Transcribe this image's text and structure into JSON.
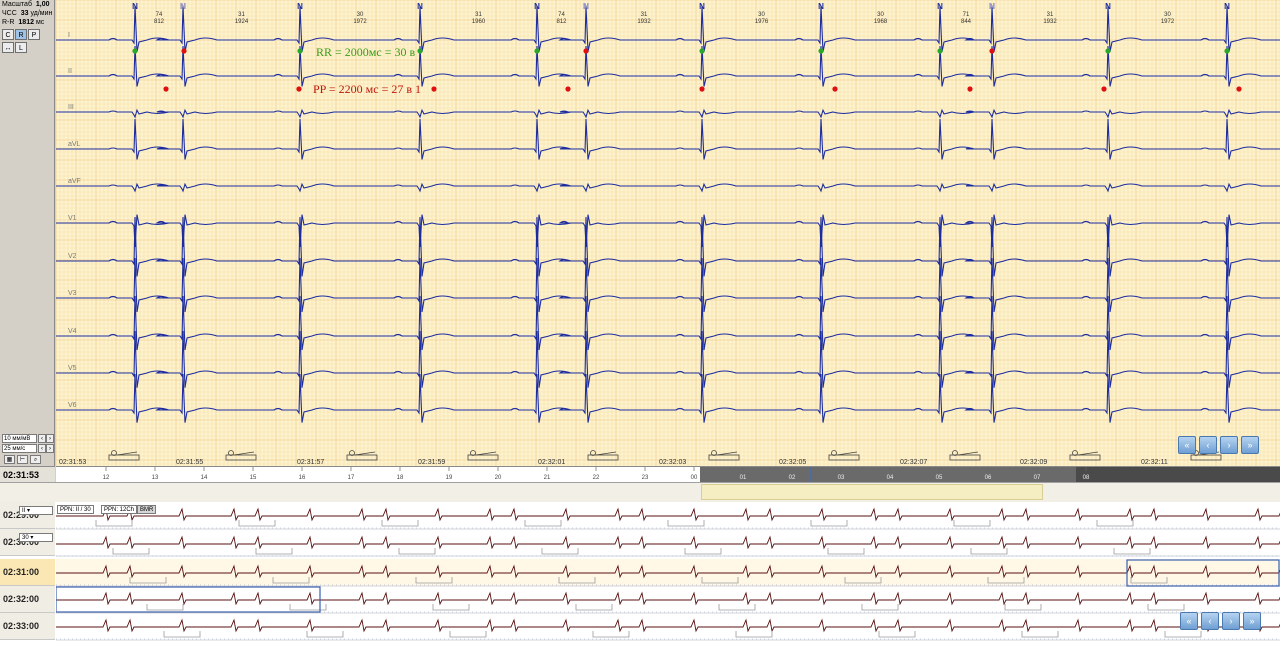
{
  "left_panel": {
    "scale_label": "Масштаб",
    "scale_value": "1,00",
    "hr_label": "ЧСС",
    "hr_value": "33",
    "hr_unit": "уд/мин",
    "rr_label": "R-R",
    "rr_value": "1812",
    "rr_unit": "мс",
    "tool_buttons": [
      "C",
      "R",
      "P",
      "↔",
      "L"
    ],
    "amplitude": "10 мм/мВ",
    "speed": "25 мм/с"
  },
  "leads": [
    "I",
    "II",
    "III",
    "aVL",
    "aVF",
    "V1",
    "V2",
    "V3",
    "V4",
    "V5",
    "V6"
  ],
  "beats": [
    {
      "type": "N",
      "rate": "",
      "interval": ""
    },
    {
      "type": "N",
      "rate": "74",
      "interval": "812"
    },
    {
      "type": "N",
      "rate": "31",
      "interval": "1924"
    },
    {
      "type": "N",
      "rate": "30",
      "interval": "1972"
    },
    {
      "type": "N",
      "rate": "31",
      "interval": "1960"
    },
    {
      "type": "N",
      "rate": "74",
      "interval": "812"
    },
    {
      "type": "N",
      "rate": "31",
      "interval": "1932"
    },
    {
      "type": "N",
      "rate": "30",
      "interval": "1976"
    },
    {
      "type": "N",
      "rate": "30",
      "interval": "1968"
    },
    {
      "type": "N",
      "rate": "71",
      "interval": "844"
    },
    {
      "type": "N",
      "rate": "31",
      "interval": "1932"
    },
    {
      "type": "N",
      "rate": "30",
      "interval": "1972"
    }
  ],
  "annotations": {
    "rr": {
      "text": "RR = 2000мс = 30 в",
      "color": "#3a9a1a"
    },
    "pp": {
      "text": "PP = 2200 мс = 27 в 1",
      "color": "#c0180c"
    }
  },
  "time_marks": [
    "02:31:53",
    "02:31:55",
    "02:31:57",
    "02:31:59",
    "02:32:01",
    "02:32:03",
    "02:32:05",
    "02:32:07",
    "02:32:09",
    "02:32:11"
  ],
  "ruler": {
    "current_time": "02:31:53",
    "numbers": [
      "12",
      "13",
      "14",
      "15",
      "16",
      "17",
      "18",
      "19",
      "20",
      "21",
      "22",
      "23",
      "00",
      "01",
      "02",
      "03",
      "04",
      "05",
      "06",
      "07",
      "08"
    ]
  },
  "lower_panel": {
    "lead_select": "II",
    "duration_select": "30",
    "button_ppn1": "PPN: II / 30",
    "button_ppn2": "PPN: 12Ch",
    "button_bmr": "BMR",
    "rows": [
      "02:29:00",
      "02:30:00",
      "02:31:00",
      "02:32:00",
      "02:33:00"
    ],
    "current_row": "02:31:00"
  },
  "colors": {
    "grid_minor": "#f6dfa6",
    "grid_major": "#eec27a",
    "ecg_trace": "#1d2da0",
    "trend_trace": "#5a1010",
    "p_wave_marker": "#e01010",
    "r_wave_marker": "#2aa82a",
    "nav_button": "#6f9fd3"
  },
  "nav_icons": [
    "double-left-icon",
    "left-icon",
    "right-icon",
    "double-right-icon"
  ]
}
